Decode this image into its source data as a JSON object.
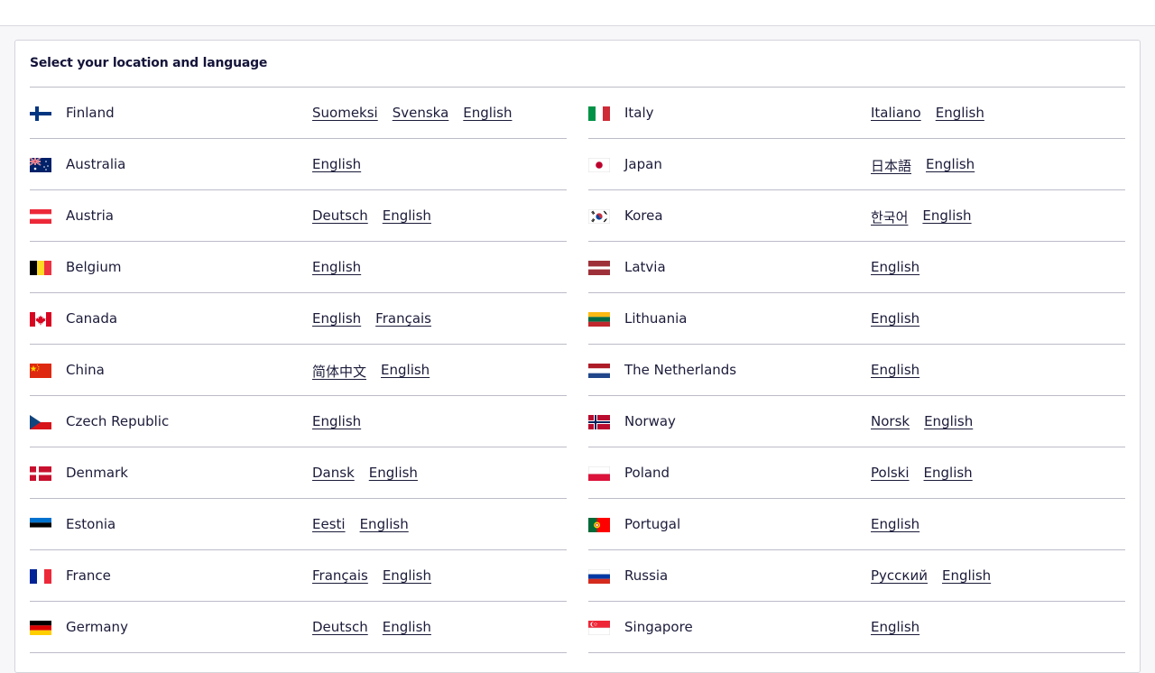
{
  "title": "Select your location and language",
  "left": [
    {
      "country": "Finland",
      "flag": "fi-flag-icon",
      "langs": [
        "Suomeksi",
        "Svenska",
        "English"
      ]
    },
    {
      "country": "Australia",
      "flag": "au-flag-icon",
      "langs": [
        "English"
      ]
    },
    {
      "country": "Austria",
      "flag": "at-flag-icon",
      "langs": [
        "Deutsch",
        "English"
      ]
    },
    {
      "country": "Belgium",
      "flag": "be-flag-icon",
      "langs": [
        "English"
      ]
    },
    {
      "country": "Canada",
      "flag": "ca-flag-icon",
      "langs": [
        "English",
        "Français"
      ]
    },
    {
      "country": "China",
      "flag": "cn-flag-icon",
      "langs": [
        "简体中文",
        "English"
      ]
    },
    {
      "country": "Czech Republic",
      "flag": "cz-flag-icon",
      "langs": [
        "English"
      ]
    },
    {
      "country": "Denmark",
      "flag": "dk-flag-icon",
      "langs": [
        "Dansk",
        "English"
      ]
    },
    {
      "country": "Estonia",
      "flag": "ee-flag-icon",
      "langs": [
        "Eesti",
        "English"
      ]
    },
    {
      "country": "France",
      "flag": "fr-flag-icon",
      "langs": [
        "Français",
        "English"
      ]
    },
    {
      "country": "Germany",
      "flag": "de-flag-icon",
      "langs": [
        "Deutsch",
        "English"
      ]
    }
  ],
  "right": [
    {
      "country": "Italy",
      "flag": "it-flag-icon",
      "langs": [
        "Italiano",
        "English"
      ]
    },
    {
      "country": "Japan",
      "flag": "jp-flag-icon",
      "langs": [
        "日本語",
        "English"
      ]
    },
    {
      "country": "Korea",
      "flag": "kr-flag-icon",
      "langs": [
        "한국어",
        "English"
      ]
    },
    {
      "country": "Latvia",
      "flag": "lv-flag-icon",
      "langs": [
        "English"
      ]
    },
    {
      "country": "Lithuania",
      "flag": "lt-flag-icon",
      "langs": [
        "English"
      ]
    },
    {
      "country": "The Netherlands",
      "flag": "nl-flag-icon",
      "langs": [
        "English"
      ]
    },
    {
      "country": "Norway",
      "flag": "no-flag-icon",
      "langs": [
        "Norsk",
        "English"
      ]
    },
    {
      "country": "Poland",
      "flag": "pl-flag-icon",
      "langs": [
        "Polski",
        "English"
      ]
    },
    {
      "country": "Portugal",
      "flag": "pt-flag-icon",
      "langs": [
        "English"
      ]
    },
    {
      "country": "Russia",
      "flag": "ru-flag-icon",
      "langs": [
        "Русский",
        "English"
      ]
    },
    {
      "country": "Singapore",
      "flag": "sg-flag-icon",
      "langs": [
        "English"
      ]
    }
  ]
}
